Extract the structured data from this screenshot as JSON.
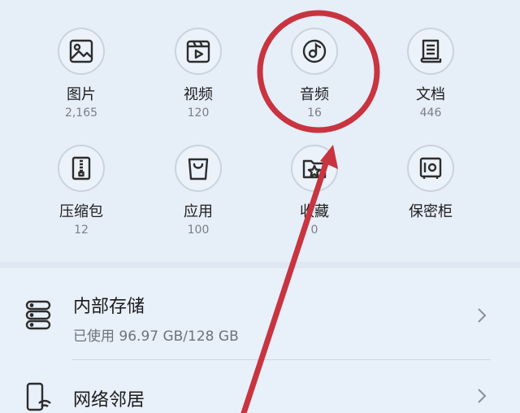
{
  "categories": [
    {
      "label": "图片",
      "count": "2,165",
      "icon": "image-icon"
    },
    {
      "label": "视频",
      "count": "120",
      "icon": "video-icon"
    },
    {
      "label": "音频",
      "count": "16",
      "icon": "audio-icon"
    },
    {
      "label": "文档",
      "count": "446",
      "icon": "document-icon"
    },
    {
      "label": "压缩包",
      "count": "12",
      "icon": "zip-icon"
    },
    {
      "label": "应用",
      "count": "100",
      "icon": "app-bag-icon"
    },
    {
      "label": "收藏",
      "count": "0",
      "icon": "favorites-folder-icon"
    },
    {
      "label": "保密柜",
      "count": "",
      "icon": "safe-icon"
    }
  ],
  "storage": {
    "internal_title": "内部存储",
    "internal_usage": "已使用 96.97 GB/128 GB",
    "network_title": "网络邻居"
  },
  "colors": {
    "background": "#e6eef8",
    "icon_stroke": "#2d2d2d",
    "annotation_red": "#c8343f"
  }
}
